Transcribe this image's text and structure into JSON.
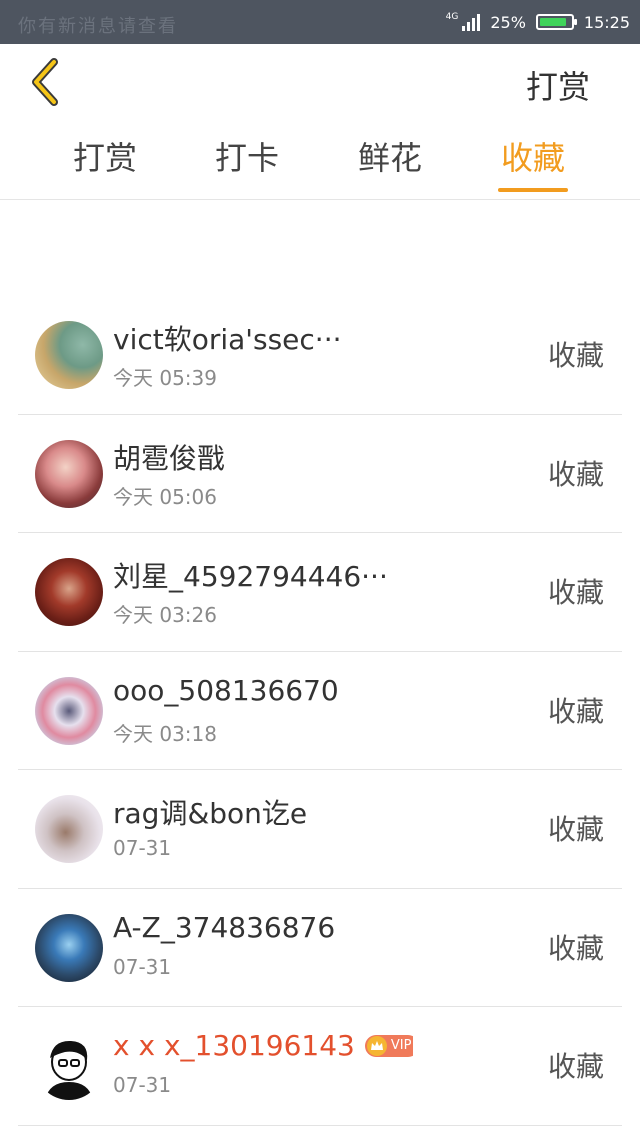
{
  "status_bar": {
    "left_text": "你有新消息请查看",
    "network": "4G",
    "battery_text": "25%",
    "battery_level": 0.88,
    "time": "15:25"
  },
  "header": {
    "back_icon": "chevron-left-icon",
    "action_label": "打赏"
  },
  "tabs": [
    {
      "label": "打赏",
      "active": false
    },
    {
      "label": "打卡",
      "active": false
    },
    {
      "label": "鲜花",
      "active": false
    },
    {
      "label": "收藏",
      "active": true
    }
  ],
  "colors": {
    "accent": "#f29c1f",
    "status_bar": "#4e5560",
    "vip_name": "#e3502d",
    "battery": "#3fd35a"
  },
  "list": [
    {
      "name": "vict软oria'ssec···",
      "time": "今天 05:39",
      "action": "收藏",
      "vip": false
    },
    {
      "name": "胡雹俊戬",
      "time": "今天 05:06",
      "action": "收藏",
      "vip": false
    },
    {
      "name": "刘星_4592794446···",
      "time": "今天 03:26",
      "action": "收藏",
      "vip": false
    },
    {
      "name": "ooo_508136670",
      "time": "今天 03:18",
      "action": "收藏",
      "vip": false
    },
    {
      "name": "rag调&bon讫e",
      "time": "07-31",
      "action": "收藏",
      "vip": false
    },
    {
      "name": "A-Z_374836876",
      "time": "07-31",
      "action": "收藏",
      "vip": false
    },
    {
      "name": "x x x_130196143",
      "time": "07-31",
      "action": "收藏",
      "vip": true,
      "vip_label": "VIP"
    }
  ]
}
